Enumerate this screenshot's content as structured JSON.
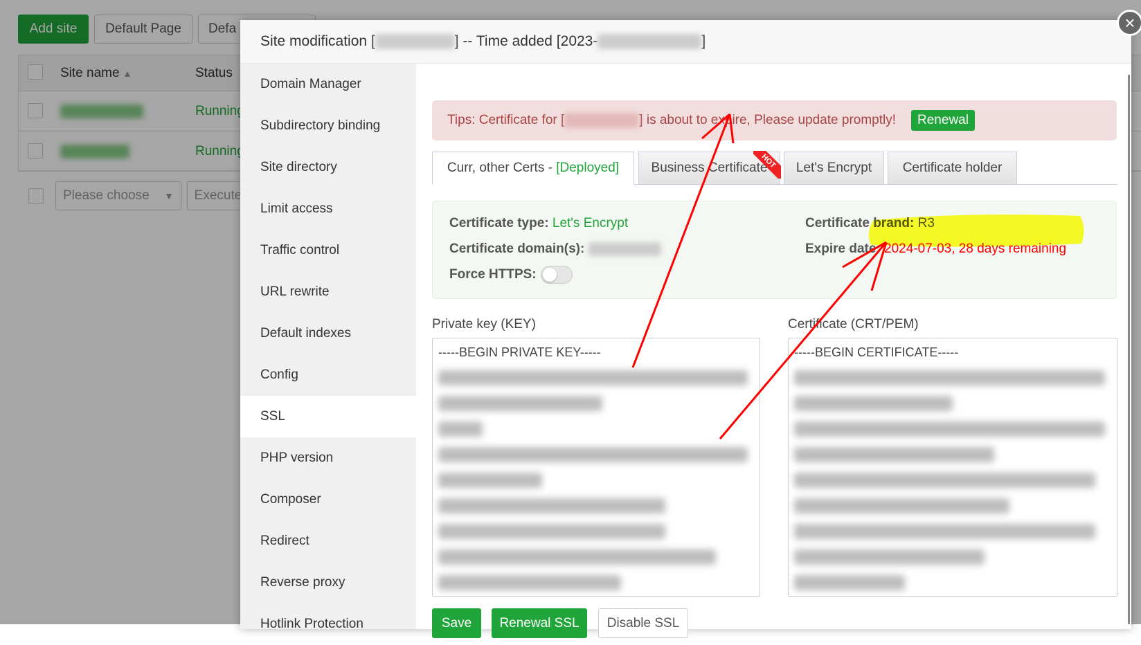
{
  "background": {
    "add_site": "Add site",
    "default_page": "Default Page",
    "default_trunc": "Defa",
    "col_site_name": "Site name",
    "col_status": "Status",
    "rows": [
      {
        "status": "Running"
      },
      {
        "status": "Running"
      }
    ],
    "please_choose": "Please choose",
    "execute": "Execute"
  },
  "modal": {
    "title_prefix": "Site modification [",
    "title_mid": "] -- Time added [2023-",
    "title_suffix": "]",
    "sidebar": [
      "Domain Manager",
      "Subdirectory binding",
      "Site directory",
      "Limit access",
      "Traffic control",
      "URL rewrite",
      "Default indexes",
      "Config",
      "SSL",
      "PHP version",
      "Composer",
      "Redirect",
      "Reverse proxy",
      "Hotlink Protection"
    ],
    "alert": {
      "prefix": "Tips: Certificate for [",
      "suffix": "] is about to expire, Please update promptly!",
      "renewal": "Renewal"
    },
    "tabs": {
      "current": "Curr, other Certs - ",
      "deployed": "[Deployed]",
      "business": "Business Certificate",
      "hot": "HOT",
      "letsencrypt": "Let's Encrypt",
      "holder": "Certificate holder"
    },
    "info": {
      "type_label": "Certificate type:",
      "type_value": "Let's Encrypt",
      "domains_label": "Certificate domain(s):",
      "https_label": "Force HTTPS:",
      "brand_label": "Certificate brand:",
      "brand_value": "R3",
      "expire_label": "Expire date:",
      "expire_value": "2024-07-03, 28 days remaining",
      "force_https": false
    },
    "key_label": "Private key (KEY)",
    "key_begin": "-----BEGIN PRIVATE KEY-----",
    "cert_label": "Certificate (CRT/PEM)",
    "cert_begin": "-----BEGIN CERTIFICATE-----",
    "buttons": {
      "save": "Save",
      "renewal_ssl": "Renewal SSL",
      "disable_ssl": "Disable SSL"
    }
  },
  "colors": {
    "accent": "#20a53a",
    "alert_text": "#a94442",
    "expire": "#ff0000",
    "highlight": "#ffff00"
  }
}
